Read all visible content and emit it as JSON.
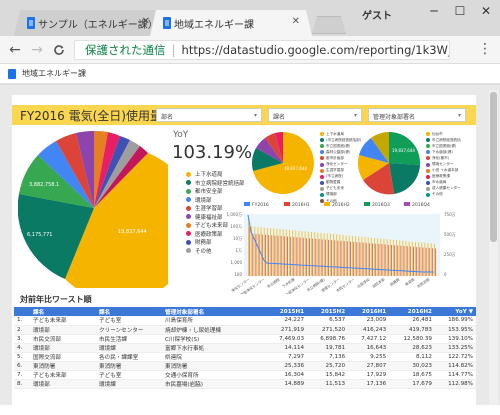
{
  "browser": {
    "tabs": [
      {
        "label": "サンプル（エネルギー課）",
        "active": false
      },
      {
        "label": "地域エネルギー課",
        "active": true
      }
    ],
    "profile": "ゲスト",
    "window_controls": {
      "minimize": "─",
      "maximize": "☐",
      "close": "✕"
    },
    "nav": {
      "back": "←",
      "forward": "→",
      "reload": "C"
    },
    "secure_label": "保護された通信",
    "url": "https://datastudio.google.com/reporting/1k3W_zVN_H...",
    "menu": "⋮"
  },
  "bookmark_bar": {
    "label": "地域エネルギー課"
  },
  "report": {
    "title": "FY2016 電気(全日)使用量",
    "filters": [
      {
        "placeholder": "部名"
      },
      {
        "placeholder": "課名"
      },
      {
        "placeholder": "管理対象部署名"
      }
    ],
    "yoy_label": "YoY",
    "yoy_value": "103.19%"
  },
  "main_pie": {
    "labels": [
      "19,837,644",
      "6,175,771",
      "3,882,758.1"
    ],
    "colors": [
      "#f4b400",
      "#0b7a64",
      "#36a852",
      "#4285f4",
      "#db4437",
      "#8e44ad",
      "#e67e22",
      "#e91e63",
      "#3f51b5",
      "#9e9e9e",
      "#c2185b"
    ],
    "legend": [
      {
        "label": "上下水道局",
        "color": "#f4b400"
      },
      {
        "label": "市立病院経営統括部",
        "color": "#0b7a64"
      },
      {
        "label": "都市安全部",
        "color": "#36a852"
      },
      {
        "label": "環境部",
        "color": "#4285f4"
      },
      {
        "label": "生涯学習部",
        "color": "#db4437"
      },
      {
        "label": "健康福祉部",
        "color": "#8e44ad"
      },
      {
        "label": "子ども未来部",
        "color": "#e67e22"
      },
      {
        "label": "医療政策部",
        "color": "#e91e63"
      },
      {
        "label": "財務部",
        "color": "#3f51b5"
      },
      {
        "label": "その他",
        "color": "#9e9e9e"
      }
    ]
  },
  "small_pie_1": {
    "label": "19,837,644",
    "legend": [
      "上下水道局",
      "(市立病院経営統括部)",
      "市立図書館(健)",
      "森林公園部(健)",
      "都市計画部",
      "浄化センター",
      "生涯学習部",
      "(市立病院)",
      "動物愛護",
      "子ども未来",
      "環境部",
      "その他"
    ]
  },
  "small_pie_2": {
    "label": "19,837,644",
    "legend": [
      "仙台市",
      "市立病院経営統括",
      "市立図書館(健)",
      "下水道部(健)",
      "浄化(都市)",
      "環境センター",
      "小田 ＋水道本部",
      "医療政策課",
      "市水道局",
      "成人健康センター",
      "その他"
    ]
  },
  "combo_chart": {
    "legend": [
      {
        "label": "FY2016",
        "color": "#4285f4"
      },
      {
        "label": "2016H1",
        "color": "#db4437"
      },
      {
        "label": "2016H2",
        "color": "#f4b400"
      },
      {
        "label": "2016Q3",
        "color": "#0f9d58"
      },
      {
        "label": "2016Q4",
        "color": "#ab47bc"
      }
    ],
    "left_axis": [
      "1,000万",
      "100万",
      "10万",
      "1万",
      "1,000",
      "100"
    ],
    "right_axis": [
      "750万",
      "500万",
      "250万",
      "0"
    ],
    "x_labels": [
      "浄化センター",
      "南部浄化センター",
      "市立病院",
      "下水処理",
      "中部浄化センター",
      "市立病院(健)",
      "環境センター",
      "市民センター",
      "北部浄化",
      "消防本部",
      "図書館",
      "体育館",
      "市民会館"
    ]
  },
  "chart_data": {
    "type": "bar",
    "categories": [
      "下水処理施設",
      "...",
      "...",
      "..."
    ],
    "series": [
      {
        "name": "FY2016",
        "values": [
          7500000,
          1000000,
          500000,
          300000
        ]
      }
    ],
    "ylabel": "",
    "xlabel": ""
  },
  "table": {
    "section_title": "対前年比ワースト順",
    "headers": [
      "",
      "課名",
      "課名",
      "管理対象部署名",
      "2015H1",
      "2015H2",
      "2016H1",
      "2016H2",
      "YoY ▼"
    ],
    "rows": [
      [
        "1.",
        "子ども未来部",
        "子ども室",
        "川島保育所",
        "24,227",
        "6,537",
        "23,009",
        "26,481",
        "186.99%"
      ],
      [
        "2.",
        "環境部",
        "クリーンセンター",
        "焼却炉棟・し尿処理棟",
        "271,919",
        "271,520",
        "416,243",
        "419,783",
        "153.95%"
      ],
      [
        "3.",
        "市民交流部",
        "市民生活課",
        "C川探学校(S)",
        "7,469.03",
        "6,898.76",
        "7,427.12",
        "12,580.39",
        "139.10%"
      ],
      [
        "4.",
        "環境部",
        "環境課",
        "富郷下水行事処",
        "14,114",
        "19,781",
        "16,643",
        "28,623",
        "133.25%"
      ],
      [
        "5.",
        "国際交流部",
        "各の民・課課室",
        "県連院",
        "7,297",
        "7,136",
        "9,255",
        "8,112",
        "122.72%"
      ],
      [
        "6.",
        "東消防署",
        "東消防署",
        "東消防署",
        "25,336",
        "25,720",
        "27,807",
        "30,023",
        "114.82%"
      ],
      [
        "7.",
        "子ども未来部",
        "子ども室",
        "交通小保育所",
        "16,304",
        "15,842",
        "17,929",
        "18,675",
        "114.77%"
      ],
      [
        "8.",
        "環境部",
        "環境課",
        "市民墓場(岩脇)",
        "14,889",
        "11,513",
        "17,136",
        "17,679",
        "112.98%"
      ]
    ]
  }
}
